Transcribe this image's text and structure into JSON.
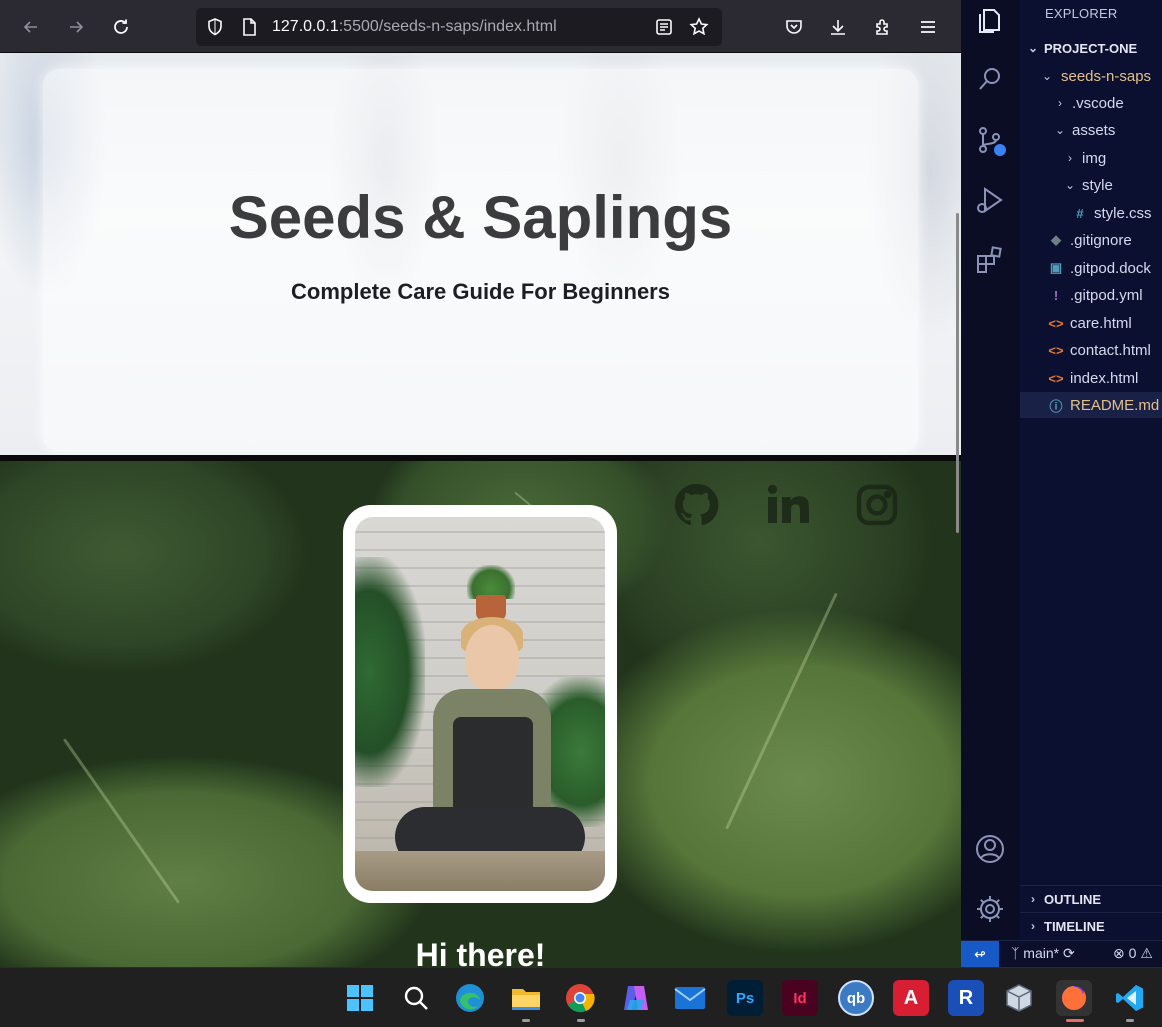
{
  "browser": {
    "url_host": "127.0.0.1",
    "url_path": ":5500/seeds-n-saps/index.html"
  },
  "page": {
    "hero_title": "Seeds & Saplings",
    "hero_subtitle": "Complete Care Guide For Beginners",
    "greeting": "Hi there!",
    "social_icons": [
      "github-icon",
      "linkedin-icon",
      "instagram-icon"
    ]
  },
  "vscode": {
    "explorer_title": "EXPLORER",
    "project": "PROJECT-ONE",
    "tree": [
      {
        "label": "seeds-n-saps",
        "type": "folder-open",
        "depth": 1,
        "modified": true
      },
      {
        "label": ".vscode",
        "type": "folder",
        "depth": 2
      },
      {
        "label": "assets",
        "type": "folder-open",
        "depth": 2
      },
      {
        "label": "img",
        "type": "folder",
        "depth": 3
      },
      {
        "label": "style",
        "type": "folder-open",
        "depth": 3
      },
      {
        "label": "style.css",
        "type": "css",
        "depth": 4
      },
      {
        "label": ".gitignore",
        "type": "git",
        "depth": 2
      },
      {
        "label": ".gitpod.dock",
        "type": "docker",
        "depth": 2
      },
      {
        "label": ".gitpod.yml",
        "type": "yml",
        "depth": 2
      },
      {
        "label": "care.html",
        "type": "html",
        "depth": 2
      },
      {
        "label": "contact.html",
        "type": "html",
        "depth": 2
      },
      {
        "label": "index.html",
        "type": "html",
        "depth": 2
      },
      {
        "label": "README.md",
        "type": "info",
        "depth": 2,
        "selected": true,
        "modified": true
      }
    ],
    "outline_label": "OUTLINE",
    "timeline_label": "TIMELINE",
    "status": {
      "branch": "main*",
      "errors": "0"
    }
  },
  "taskbar": {
    "apps": [
      "windows-start",
      "search",
      "edge",
      "file-explorer",
      "chrome",
      "copilot",
      "mail",
      "photoshop",
      "indesign",
      "qbittorrent",
      "autocad",
      "revit",
      "virtualbox",
      "firefox",
      "vscode"
    ],
    "ps_label": "Ps",
    "id_label": "Id",
    "qb_label": "qb",
    "cad_label": "A",
    "rvt_label": "R"
  },
  "colors": {
    "accent_blue": "#1659c7",
    "firefox_active": "#e86a6a"
  }
}
